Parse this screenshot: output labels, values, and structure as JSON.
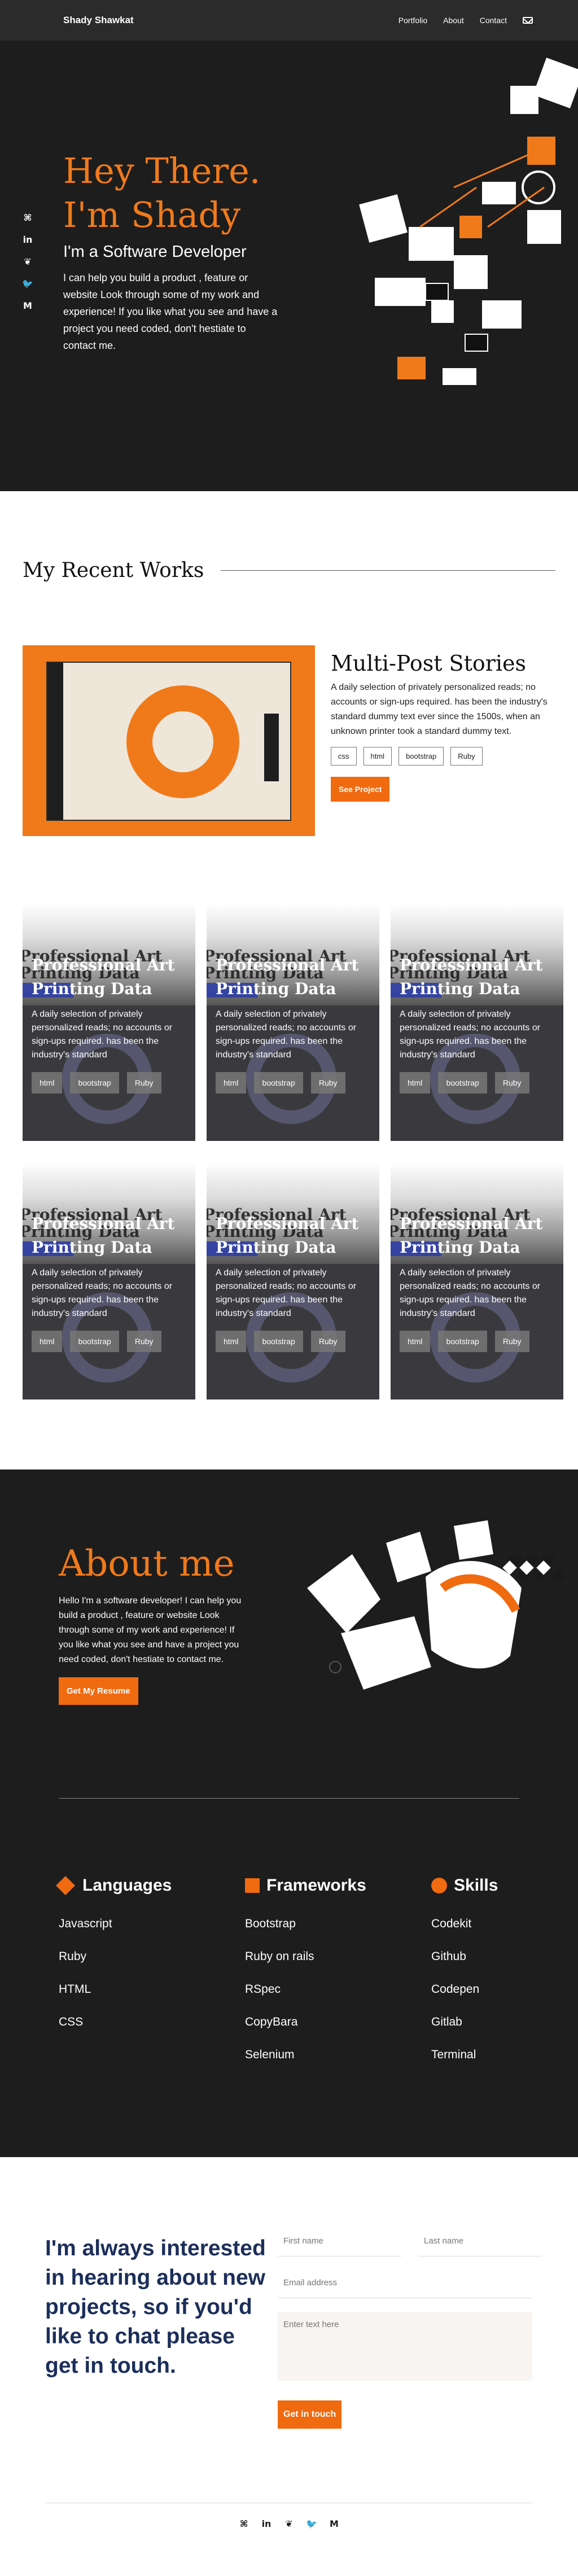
{
  "nav": {
    "brand": "Shady Shawkat",
    "links": [
      "Portfolio",
      "About",
      "Contact"
    ],
    "mail_icon": "mail-icon"
  },
  "social": {
    "icons": [
      "github-icon",
      "linkedin-icon",
      "codepen-icon",
      "twitter-icon",
      "medium-icon"
    ],
    "glyphs": [
      "⌘",
      "in",
      "❦",
      "🐦",
      "M"
    ]
  },
  "hero": {
    "heading_line1": "Hey There.",
    "heading_line2": "I'm Shady",
    "subheading": "I'm a Software Developer",
    "description": "I can help you build a product , feature or website Look through some of my work and experience! If you like what you see and have a project you need coded, don't hestiate to contact me.",
    "accent_color": "#f07a1a",
    "bg_color": "#1d1d1d"
  },
  "works": {
    "title": "My Recent Works",
    "featured": {
      "title": "Multi-Post Stories",
      "description": "A daily selection of privately personalized reads; no accounts or sign-ups required. has been the industry's standard dummy text ever since the 1500s, when an unknown printer took a galley of type and scrambled it to make a type specimen book.",
      "description_visible": "A daily selection of privately personalized reads; no accounts or sign-ups required. has been the industry's standard dummy text ever since the 1500s, when an unknown printer took a standard dummy text.",
      "tags": [
        "css",
        "html",
        "bootstrap",
        "Ruby"
      ],
      "button": "See Project"
    },
    "cards": [
      {
        "ghost": "Professional Art Printing Data",
        "title": "Professional Art Printing Data",
        "description": "A daily selection of privately personalized reads; no accounts or sign-ups required. has been the industry's standard",
        "tags": [
          "html",
          "bootstrap",
          "Ruby"
        ]
      },
      {
        "ghost": "Professional Art Printing Data",
        "title": "Professional Art Printing Data",
        "description": "A daily selection of privately personalized reads; no accounts or sign-ups required. has been the industry's standard",
        "tags": [
          "html",
          "bootstrap",
          "Ruby"
        ]
      },
      {
        "ghost": "Professional Art Printing Data",
        "title": "Professional Art Printing Data",
        "description": "A daily selection of privately personalized reads; no accounts or sign-ups required. has been the industry's standard",
        "tags": [
          "html",
          "bootstrap",
          "Ruby"
        ]
      },
      {
        "ghost": "Professional Art Printing Data",
        "title": "Professional Art Printing Data",
        "description": "A daily selection of privately personalized reads; no accounts or sign-ups required. has been the industry's standard",
        "tags": [
          "html",
          "bootstrap",
          "Ruby"
        ]
      },
      {
        "ghost": "Professional Art Printing Data",
        "title": "Professional Art Printing Data",
        "description": "A daily selection of privately personalized reads; no accounts or sign-ups required. has been the industry's standard",
        "tags": [
          "html",
          "bootstrap",
          "Ruby"
        ]
      },
      {
        "ghost": "Professional Art Printing Data",
        "title": "Professional Art Printing Data",
        "description": "A daily selection of privately personalized reads; no accounts or sign-ups required. has been the industry's standard",
        "tags": [
          "html",
          "bootstrap",
          "Ruby"
        ]
      }
    ]
  },
  "about": {
    "title": "About me",
    "description": "Hello I'm a software developer! I can help you build a product , feature or website Look through some of my work and experience! If you like what you see and have a project you need coded, don't hestiate to contact me.",
    "button": "Get My Resume",
    "skills": [
      {
        "title": "Languages",
        "icon": "diamond-icon",
        "items": [
          "Javascript",
          "Ruby",
          "HTML",
          "CSS"
        ]
      },
      {
        "title": "Frameworks",
        "icon": "square-icon",
        "items": [
          "Bootstrap",
          "Ruby on rails",
          "RSpec",
          "CopyBara",
          "Selenium"
        ]
      },
      {
        "title": "Skills",
        "icon": "circle-icon",
        "items": [
          "Codekit",
          "Github",
          "Codepen",
          "Gitlab",
          "Terminal"
        ]
      }
    ]
  },
  "contact": {
    "text": "I'm always interested in hearing about new projects, so if you'd like to chat please get in touch.",
    "first_name_placeholder": "First name",
    "last_name_placeholder": "Last name",
    "email_placeholder": "Email address",
    "message_placeholder": "Enter text here",
    "button": "Get in touch"
  }
}
